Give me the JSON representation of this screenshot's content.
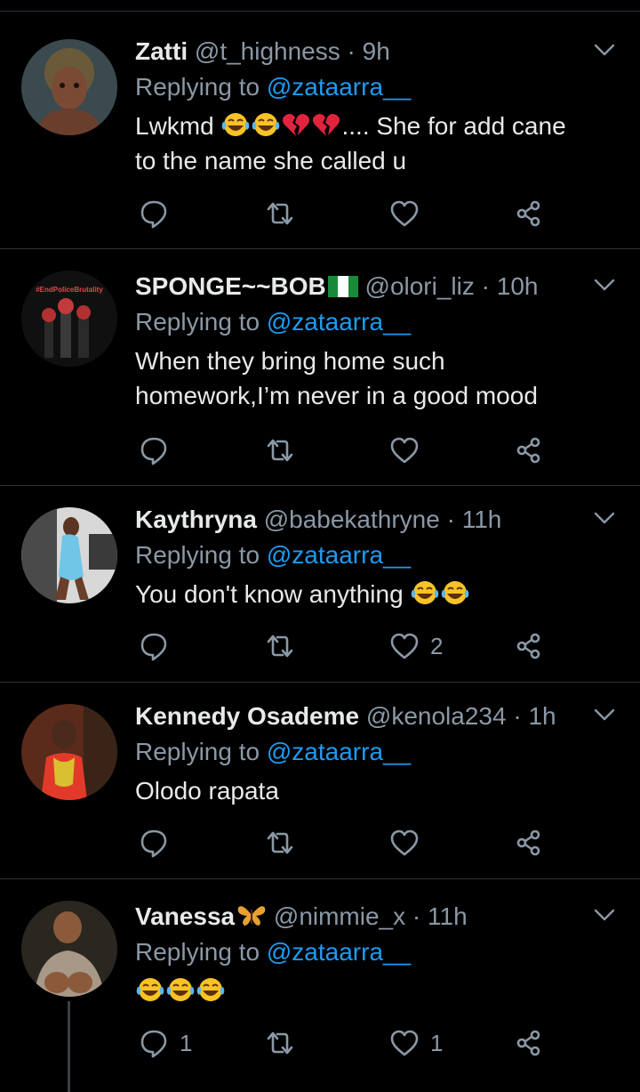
{
  "colors": {
    "background": "#000000",
    "text": "#e7e9ea",
    "muted": "#8b98a5",
    "link": "#1d9bf0",
    "divider": "#2f3336"
  },
  "tweets": [
    {
      "name": "Zatti",
      "handle": "@t_highness",
      "time": "9h",
      "badge": "",
      "reply_prefix": "Replying to",
      "reply_to": "@zataarra__",
      "text_before": "Lwkmd",
      "text_after": ".... She for add cane to the name she called u",
      "emojis": [
        "face-with-tears-of-joy-icon",
        "face-with-tears-of-joy-icon",
        "broken-heart-icon",
        "broken-heart-icon"
      ],
      "reply_count": "",
      "like_count": ""
    },
    {
      "name": "SPONGE~~BOB",
      "handle": "@olori_liz",
      "time": "10h",
      "badge": "nigeria-flag-icon",
      "reply_prefix": "Replying to",
      "reply_to": "@zataarra__",
      "text_before": "When they bring home such homework,I’m never in a good mood",
      "text_after": "",
      "emojis": [],
      "avatar_text": "#EndPoliceBrutality",
      "reply_count": "",
      "like_count": ""
    },
    {
      "name": "Kaythryna",
      "handle": "@babekathryne",
      "time": "11h",
      "badge": "",
      "reply_prefix": "Replying to",
      "reply_to": "@zataarra__",
      "text_before": "You don't know anything",
      "text_after": "",
      "emojis": [
        "face-with-tears-of-joy-icon",
        "face-with-tears-of-joy-icon"
      ],
      "reply_count": "",
      "like_count": "2"
    },
    {
      "name": "Kennedy Osademe",
      "handle": "@kenola234",
      "time": "1h",
      "badge": "",
      "reply_prefix": "Replying to",
      "reply_to": "@zataarra__",
      "text_before": "Olodo rapata",
      "text_after": "",
      "emojis": [],
      "reply_count": "",
      "like_count": ""
    },
    {
      "name": "Vanessa",
      "handle": "@nimmie_x",
      "time": "11h",
      "badge": "butterfly-icon",
      "reply_prefix": "Replying to",
      "reply_to": "@zataarra__",
      "text_before": "",
      "text_after": "",
      "emojis": [
        "face-with-tears-of-joy-icon",
        "face-with-tears-of-joy-icon",
        "face-with-tears-of-joy-icon"
      ],
      "reply_count": "1",
      "like_count": "1"
    }
  ],
  "separator": "·"
}
